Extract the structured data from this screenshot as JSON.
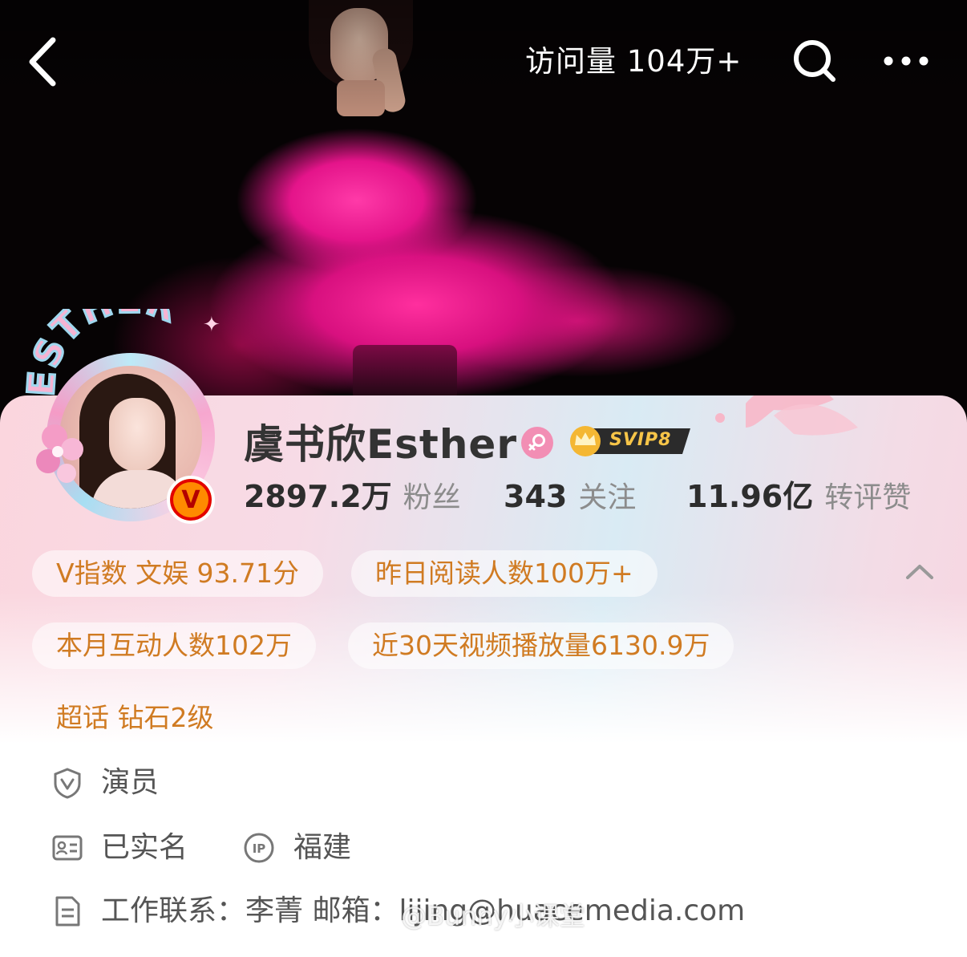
{
  "header": {
    "visits": "访问量 104万+"
  },
  "profile": {
    "avatar_frame_text": "ESTHER",
    "verified_badge": "V",
    "name": "虞书欣Esther",
    "vip_badge": "SVIP8",
    "stats": [
      {
        "value": "2897.2万",
        "label": "粉丝"
      },
      {
        "value": "343",
        "label": "关注"
      },
      {
        "value": "11.96亿",
        "label": "转评赞"
      }
    ]
  },
  "chips": {
    "v_index": "V指数 文娱 93.71分",
    "yesterday_reads": "昨日阅读人数100万+",
    "monthly_interactions": "本月互动人数102万",
    "video_plays": "近30天视频播放量6130.9万",
    "super_topic": "超话 钻石2级"
  },
  "info": {
    "occupation": "演员",
    "real_name": "已实名",
    "ip_badge": "IP",
    "location": "福建",
    "work_contact": "工作联系：李菁  邮箱：lijing@huacemedia.com"
  },
  "watermark": "@Bunny小课堂",
  "colors": {
    "chip_text": "#d07b22",
    "name_text": "#333333",
    "stat_label": "#8c8c8c"
  },
  "icons": [
    "back-icon",
    "search-icon",
    "more-icon",
    "gender-female-icon",
    "crown-icon",
    "chevron-up-icon",
    "shield-v-icon",
    "id-card-icon",
    "ip-icon",
    "document-icon"
  ]
}
